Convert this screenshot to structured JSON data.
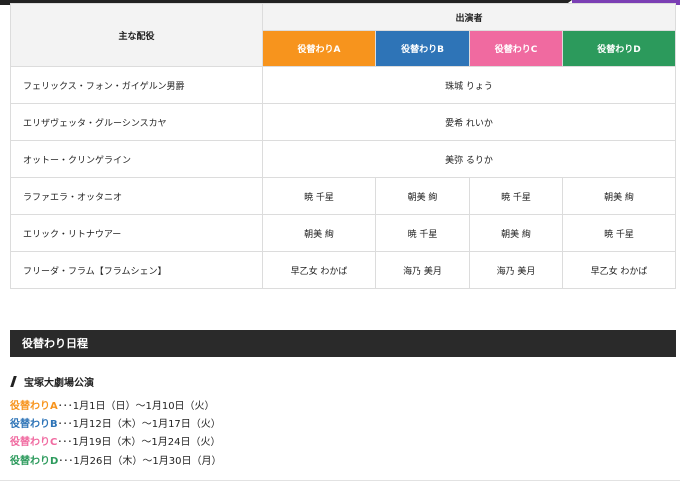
{
  "colors": {
    "altA": "#f7941d",
    "altB": "#2e74b7",
    "altC": "#f06aa0",
    "altD": "#2c9a5c",
    "section_bar": "#2a2a2a"
  },
  "table": {
    "role_header": "主な配役",
    "performer_header": "出演者",
    "alternates": [
      "役替わりA",
      "役替わりB",
      "役替わりC",
      "役替わりD"
    ],
    "rows": [
      {
        "role": "フェリックス・フォン・ガイゲルン男爵",
        "all": "珠城 りょう"
      },
      {
        "role": "エリザヴェッタ・グルーシンスカヤ",
        "all": "愛希 れいか"
      },
      {
        "role": "オットー・クリンゲライン",
        "all": "美弥 るりか"
      },
      {
        "role": "ラファエラ・オッタニオ",
        "cells": [
          "暁 千星",
          "朝美 絢",
          "暁 千星",
          "朝美 絢"
        ]
      },
      {
        "role": "エリック・リトナウアー",
        "cells": [
          "朝美 絢",
          "暁 千星",
          "朝美 絢",
          "暁 千星"
        ]
      },
      {
        "role": "フリーダ・フラム【フラムシェン】",
        "cells": [
          "早乙女 わかば",
          "海乃 美月",
          "海乃 美月",
          "早乙女 わかば"
        ]
      }
    ]
  },
  "section_title": "役替わり日程",
  "venue": "宝塚大劇場公演",
  "schedule": [
    {
      "label": "役替わりA",
      "dates": "･･･1月1日（日）～1月10日（火）"
    },
    {
      "label": "役替わりB",
      "dates": "･･･1月12日（木）～1月17日（火）"
    },
    {
      "label": "役替わりC",
      "dates": "･･･1月19日（木）～1月24日（火）"
    },
    {
      "label": "役替わりD",
      "dates": "･･･1月26日（木）～1月30日（月）"
    }
  ]
}
